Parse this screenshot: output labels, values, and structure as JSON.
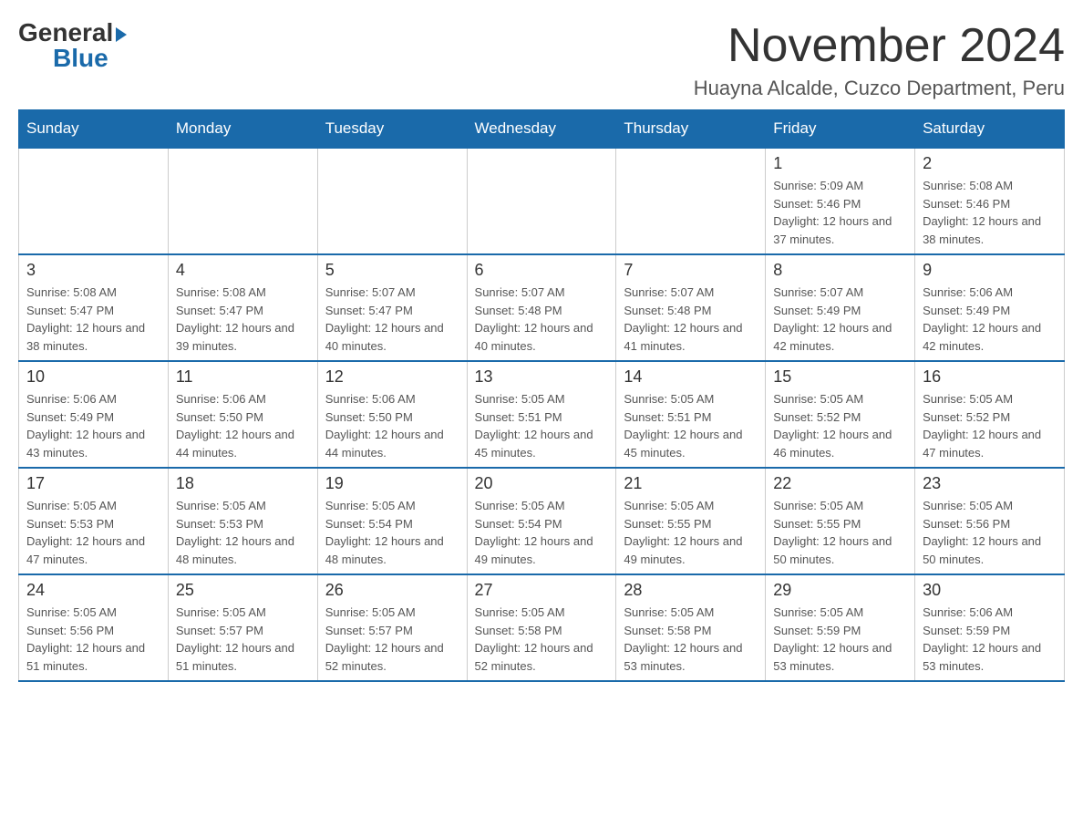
{
  "header": {
    "logo": {
      "general": "General",
      "blue": "Blue"
    },
    "month_title": "November 2024",
    "location": "Huayna Alcalde, Cuzco Department, Peru"
  },
  "calendar": {
    "days_of_week": [
      "Sunday",
      "Monday",
      "Tuesday",
      "Wednesday",
      "Thursday",
      "Friday",
      "Saturday"
    ],
    "weeks": [
      [
        {
          "day": "",
          "info": ""
        },
        {
          "day": "",
          "info": ""
        },
        {
          "day": "",
          "info": ""
        },
        {
          "day": "",
          "info": ""
        },
        {
          "day": "",
          "info": ""
        },
        {
          "day": "1",
          "info": "Sunrise: 5:09 AM\nSunset: 5:46 PM\nDaylight: 12 hours and 37 minutes."
        },
        {
          "day": "2",
          "info": "Sunrise: 5:08 AM\nSunset: 5:46 PM\nDaylight: 12 hours and 38 minutes."
        }
      ],
      [
        {
          "day": "3",
          "info": "Sunrise: 5:08 AM\nSunset: 5:47 PM\nDaylight: 12 hours and 38 minutes."
        },
        {
          "day": "4",
          "info": "Sunrise: 5:08 AM\nSunset: 5:47 PM\nDaylight: 12 hours and 39 minutes."
        },
        {
          "day": "5",
          "info": "Sunrise: 5:07 AM\nSunset: 5:47 PM\nDaylight: 12 hours and 40 minutes."
        },
        {
          "day": "6",
          "info": "Sunrise: 5:07 AM\nSunset: 5:48 PM\nDaylight: 12 hours and 40 minutes."
        },
        {
          "day": "7",
          "info": "Sunrise: 5:07 AM\nSunset: 5:48 PM\nDaylight: 12 hours and 41 minutes."
        },
        {
          "day": "8",
          "info": "Sunrise: 5:07 AM\nSunset: 5:49 PM\nDaylight: 12 hours and 42 minutes."
        },
        {
          "day": "9",
          "info": "Sunrise: 5:06 AM\nSunset: 5:49 PM\nDaylight: 12 hours and 42 minutes."
        }
      ],
      [
        {
          "day": "10",
          "info": "Sunrise: 5:06 AM\nSunset: 5:49 PM\nDaylight: 12 hours and 43 minutes."
        },
        {
          "day": "11",
          "info": "Sunrise: 5:06 AM\nSunset: 5:50 PM\nDaylight: 12 hours and 44 minutes."
        },
        {
          "day": "12",
          "info": "Sunrise: 5:06 AM\nSunset: 5:50 PM\nDaylight: 12 hours and 44 minutes."
        },
        {
          "day": "13",
          "info": "Sunrise: 5:05 AM\nSunset: 5:51 PM\nDaylight: 12 hours and 45 minutes."
        },
        {
          "day": "14",
          "info": "Sunrise: 5:05 AM\nSunset: 5:51 PM\nDaylight: 12 hours and 45 minutes."
        },
        {
          "day": "15",
          "info": "Sunrise: 5:05 AM\nSunset: 5:52 PM\nDaylight: 12 hours and 46 minutes."
        },
        {
          "day": "16",
          "info": "Sunrise: 5:05 AM\nSunset: 5:52 PM\nDaylight: 12 hours and 47 minutes."
        }
      ],
      [
        {
          "day": "17",
          "info": "Sunrise: 5:05 AM\nSunset: 5:53 PM\nDaylight: 12 hours and 47 minutes."
        },
        {
          "day": "18",
          "info": "Sunrise: 5:05 AM\nSunset: 5:53 PM\nDaylight: 12 hours and 48 minutes."
        },
        {
          "day": "19",
          "info": "Sunrise: 5:05 AM\nSunset: 5:54 PM\nDaylight: 12 hours and 48 minutes."
        },
        {
          "day": "20",
          "info": "Sunrise: 5:05 AM\nSunset: 5:54 PM\nDaylight: 12 hours and 49 minutes."
        },
        {
          "day": "21",
          "info": "Sunrise: 5:05 AM\nSunset: 5:55 PM\nDaylight: 12 hours and 49 minutes."
        },
        {
          "day": "22",
          "info": "Sunrise: 5:05 AM\nSunset: 5:55 PM\nDaylight: 12 hours and 50 minutes."
        },
        {
          "day": "23",
          "info": "Sunrise: 5:05 AM\nSunset: 5:56 PM\nDaylight: 12 hours and 50 minutes."
        }
      ],
      [
        {
          "day": "24",
          "info": "Sunrise: 5:05 AM\nSunset: 5:56 PM\nDaylight: 12 hours and 51 minutes."
        },
        {
          "day": "25",
          "info": "Sunrise: 5:05 AM\nSunset: 5:57 PM\nDaylight: 12 hours and 51 minutes."
        },
        {
          "day": "26",
          "info": "Sunrise: 5:05 AM\nSunset: 5:57 PM\nDaylight: 12 hours and 52 minutes."
        },
        {
          "day": "27",
          "info": "Sunrise: 5:05 AM\nSunset: 5:58 PM\nDaylight: 12 hours and 52 minutes."
        },
        {
          "day": "28",
          "info": "Sunrise: 5:05 AM\nSunset: 5:58 PM\nDaylight: 12 hours and 53 minutes."
        },
        {
          "day": "29",
          "info": "Sunrise: 5:05 AM\nSunset: 5:59 PM\nDaylight: 12 hours and 53 minutes."
        },
        {
          "day": "30",
          "info": "Sunrise: 5:06 AM\nSunset: 5:59 PM\nDaylight: 12 hours and 53 minutes."
        }
      ]
    ]
  }
}
